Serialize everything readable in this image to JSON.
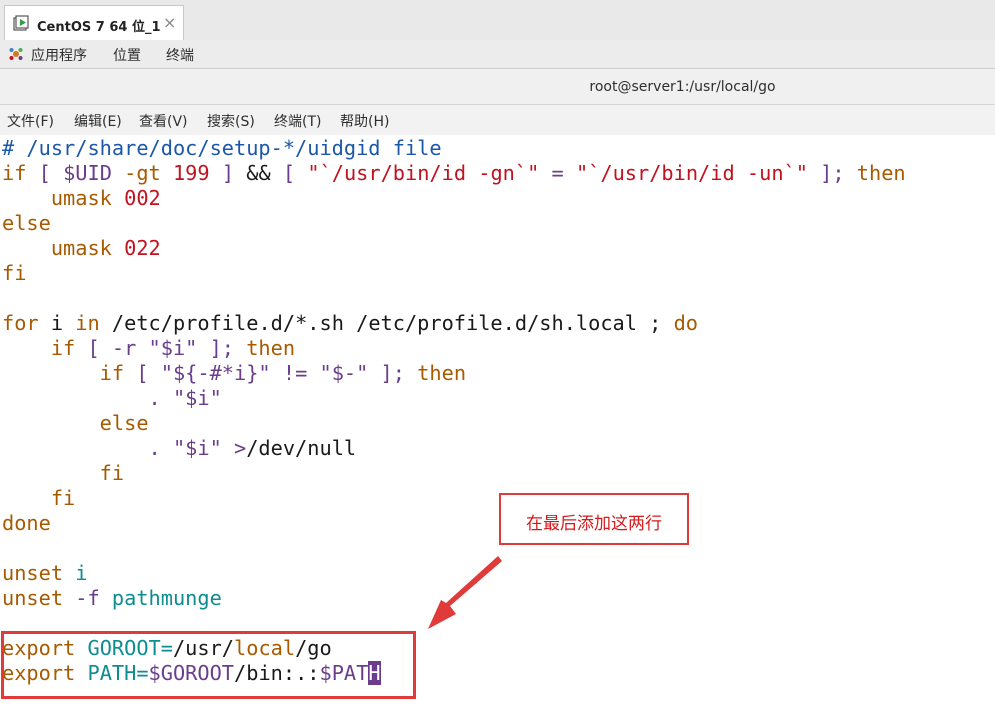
{
  "vm_tab": {
    "title": "CentOS 7 64 位_1",
    "close": "×"
  },
  "top_panel": {
    "applications": "应用程序",
    "places": "位置",
    "terminal": "终端"
  },
  "window": {
    "title": "root@server1:/usr/local/go"
  },
  "menu": [
    "文件(F)",
    "编辑(E)",
    "查看(V)",
    "搜索(S)",
    "终端(T)",
    "帮助(H)"
  ],
  "terminal": {
    "lines": [
      [
        {
          "t": "# /usr/share/doc/setup-*/uidgid file",
          "c": "cm"
        }
      ],
      [
        {
          "t": "if",
          "c": "kw"
        },
        {
          "t": " [ ",
          "c": "spc"
        },
        {
          "t": "$UID",
          "c": "spc"
        },
        {
          "t": " -gt ",
          "c": "kw"
        },
        {
          "t": "199",
          "c": "str"
        },
        {
          "t": " ] ",
          "c": "spc"
        },
        {
          "t": "&& ",
          "c": ""
        },
        {
          "t": "[ ",
          "c": "spc"
        },
        {
          "t": "\"`/usr/bin/id -gn`\"",
          "c": "str"
        },
        {
          "t": " = ",
          "c": "spc"
        },
        {
          "t": "\"`/usr/bin/id -un`\"",
          "c": "str"
        },
        {
          "t": " ]; ",
          "c": "spc"
        },
        {
          "t": "then",
          "c": "kw"
        }
      ],
      [
        {
          "t": "    umask ",
          "c": "kw"
        },
        {
          "t": "002",
          "c": "str"
        }
      ],
      [
        {
          "t": "else",
          "c": "kw"
        }
      ],
      [
        {
          "t": "    umask ",
          "c": "kw"
        },
        {
          "t": "022",
          "c": "str"
        }
      ],
      [
        {
          "t": "fi",
          "c": "kw"
        }
      ],
      [
        {
          "t": "",
          "c": ""
        }
      ],
      [
        {
          "t": "for",
          "c": "kw"
        },
        {
          "t": " i ",
          "c": ""
        },
        {
          "t": "in",
          "c": "kw"
        },
        {
          "t": " /etc/profile.d/*.sh /etc/profile.d/sh.local ; ",
          "c": ""
        },
        {
          "t": "do",
          "c": "kw"
        }
      ],
      [
        {
          "t": "    if",
          "c": "kw"
        },
        {
          "t": " [ -r ",
          "c": "spc"
        },
        {
          "t": "\"$i\"",
          "c": "spc"
        },
        {
          "t": " ]; ",
          "c": "spc"
        },
        {
          "t": "then",
          "c": "kw"
        }
      ],
      [
        {
          "t": "        if",
          "c": "kw"
        },
        {
          "t": " [ ",
          "c": "spc"
        },
        {
          "t": "\"${-#*i}\"",
          "c": "spc"
        },
        {
          "t": " != ",
          "c": "spc"
        },
        {
          "t": "\"$-\"",
          "c": "spc"
        },
        {
          "t": " ]; ",
          "c": "spc"
        },
        {
          "t": "then",
          "c": "kw"
        }
      ],
      [
        {
          "t": "            . ",
          "c": "spc"
        },
        {
          "t": "\"$i\"",
          "c": "spc"
        }
      ],
      [
        {
          "t": "        else",
          "c": "kw"
        }
      ],
      [
        {
          "t": "            . ",
          "c": "spc"
        },
        {
          "t": "\"$i\"",
          "c": "spc"
        },
        {
          "t": " >",
          "c": "spc"
        },
        {
          "t": "/dev/null",
          "c": ""
        }
      ],
      [
        {
          "t": "        fi",
          "c": "kw"
        }
      ],
      [
        {
          "t": "    fi",
          "c": "kw"
        }
      ],
      [
        {
          "t": "done",
          "c": "kw"
        }
      ],
      [
        {
          "t": "",
          "c": ""
        }
      ],
      [
        {
          "t": "unset ",
          "c": "kw"
        },
        {
          "t": "i",
          "c": "var"
        }
      ],
      [
        {
          "t": "unset ",
          "c": "kw"
        },
        {
          "t": "-f ",
          "c": "spc"
        },
        {
          "t": "pathmunge",
          "c": "var"
        }
      ],
      [
        {
          "t": "",
          "c": ""
        }
      ],
      [
        {
          "t": "export ",
          "c": "kw"
        },
        {
          "t": "GOROOT=",
          "c": "var"
        },
        {
          "t": "/usr/",
          "c": ""
        },
        {
          "t": "local",
          "c": "kw"
        },
        {
          "t": "/go",
          "c": ""
        }
      ],
      [
        {
          "t": "export ",
          "c": "kw"
        },
        {
          "t": "PATH=",
          "c": "var"
        },
        {
          "t": "$GOROOT",
          "c": "spc"
        },
        {
          "t": "/bin:.:",
          "c": ""
        },
        {
          "t": "$PAT",
          "c": "spc"
        },
        {
          "t": "H",
          "c": "cursor"
        }
      ]
    ]
  },
  "annotation": {
    "callout": "在最后添加这两行"
  },
  "colors": {
    "comment": "#1c58a8",
    "keyword": "#a85a00",
    "variable": "#0e8d91",
    "string": "#c1121f",
    "special": "#6a3e8c",
    "annotation_red": "#e03a3a"
  }
}
